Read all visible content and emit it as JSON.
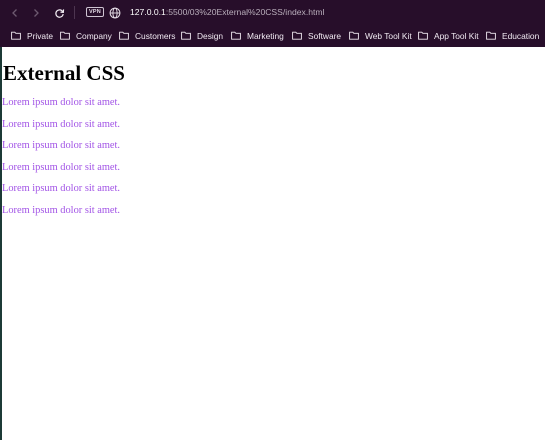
{
  "browser": {
    "url_host": "127.0.0.1",
    "url_path": ":5500/03%20External%20CSS/index.html",
    "vpn_label": "VPN",
    "bookmarks": [
      {
        "label": "Private"
      },
      {
        "label": "Company"
      },
      {
        "label": "Customers"
      },
      {
        "label": "Design"
      },
      {
        "label": "Marketing"
      },
      {
        "label": "Software"
      },
      {
        "label": "Web Tool Kit"
      },
      {
        "label": "App Tool Kit"
      },
      {
        "label": "Education"
      }
    ]
  },
  "page": {
    "heading": "External CSS",
    "paragraphs": [
      "Lorem ipsum dolor sit amet.",
      "Lorem ipsum dolor sit amet.",
      "Lorem ipsum dolor sit amet.",
      "Lorem ipsum dolor sit amet.",
      "Lorem ipsum dolor sit amet.",
      "Lorem ipsum dolor sit amet."
    ]
  },
  "colors": {
    "chrome_background": "#270e2a",
    "paragraph_text": "#a254e6",
    "heading_text": "#000000"
  }
}
